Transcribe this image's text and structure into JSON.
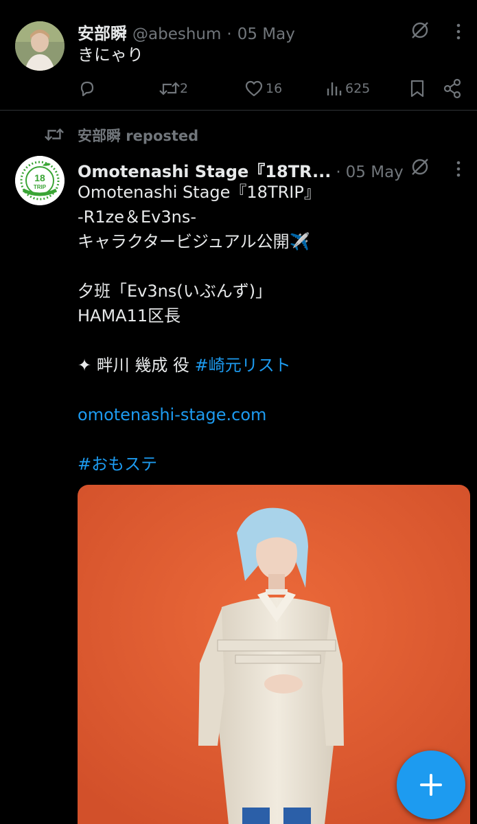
{
  "post1": {
    "author_name": "安部瞬",
    "handle": "@abeshum",
    "dot": "·",
    "date": "05 May",
    "text": "きにゃり",
    "actions": {
      "reply_count": "",
      "repost_count": "2",
      "like_count": "16",
      "views_count": "625"
    }
  },
  "post2": {
    "repost_label": "安部瞬 reposted",
    "author_name": "Omotenashi Stage『18TR...",
    "dot": "·",
    "date": "05 May",
    "avatar_text": "18TRIP",
    "lines": [
      "Omotenashi Stage『18TRIP』",
      "-R1ze＆Ev3ns-",
      "キャラクタービジュアル公開",
      "夕班「Ev3ns(いぶんず)」",
      "HAMA11区長"
    ],
    "role_prefix": "✦ 畔川 幾成 役 ",
    "role_hashtag": "#崎元リスト",
    "link": "omotenashi-stage.com",
    "hashtag": "#おもステ",
    "plane_emoji": "✈️"
  },
  "fab": {
    "icon": "plus-icon"
  },
  "colors": {
    "accent": "#1d9bf0",
    "background": "#000000",
    "muted": "#71767b",
    "text": "#e7e9ea"
  }
}
